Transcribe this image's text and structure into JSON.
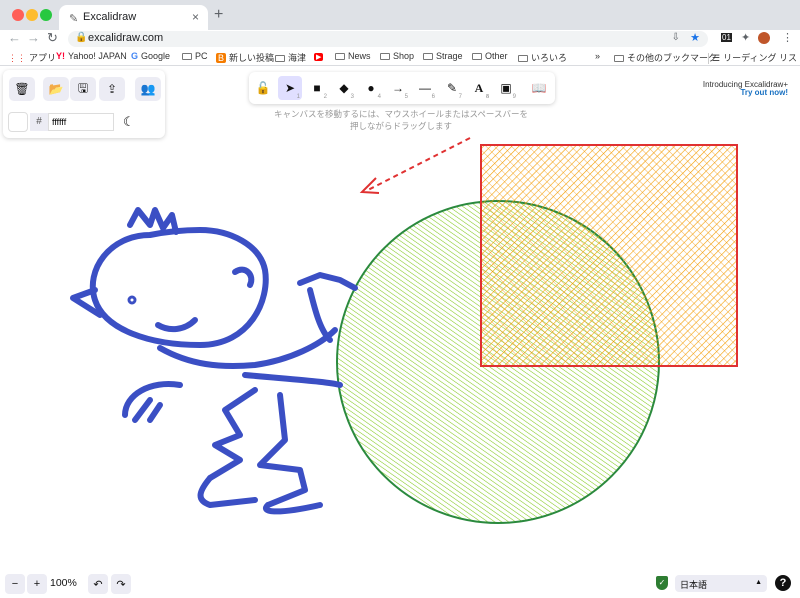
{
  "browser": {
    "tab_title": "Excalidraw",
    "url": "excalidraw.com",
    "new_tab": "+",
    "close_tab": "×",
    "ext_badge": "01"
  },
  "bookmarks": [
    {
      "label": "アプリ",
      "icon": "apps-grid-icon"
    },
    {
      "label": "Yahoo! JAPAN",
      "icon": "yahoo-icon"
    },
    {
      "label": "Google",
      "icon": "google-icon"
    },
    {
      "label": "PC",
      "icon": "folder-icon"
    },
    {
      "label": "新しい投稿",
      "icon": "blogger-icon"
    },
    {
      "label": "海津",
      "icon": "folder-icon"
    },
    {
      "label": "",
      "icon": "youtube-icon"
    },
    {
      "label": "News",
      "icon": "folder-icon"
    },
    {
      "label": "Shop",
      "icon": "folder-icon"
    },
    {
      "label": "Strage",
      "icon": "folder-icon"
    },
    {
      "label": "Other",
      "icon": "folder-icon"
    },
    {
      "label": "いろいろ",
      "icon": "folder-icon"
    }
  ],
  "bookmarks_right": {
    "more": "»",
    "other": "その他のブックマーク",
    "reading_list": "リーディング リスト"
  },
  "app": {
    "bg_hash": "#",
    "bg_color_value": "ffffff",
    "hint_line1": "キャンバスを移動するには、マウスホイールまたはスペースバーを",
    "hint_line2": "押しながらドラッグします",
    "promo_title": "Introducing Excalidraw+",
    "promo_link": "Try out now!",
    "zoom": "100%",
    "language": "日本語",
    "help": "?"
  },
  "tools": [
    {
      "name": "tool-lock",
      "glyph": "🔓",
      "num": ""
    },
    {
      "name": "tool-selection",
      "glyph": "➤",
      "num": "1"
    },
    {
      "name": "tool-rectangle",
      "glyph": "■",
      "num": "2"
    },
    {
      "name": "tool-diamond",
      "glyph": "◆",
      "num": "3"
    },
    {
      "name": "tool-ellipse",
      "glyph": "●",
      "num": "4"
    },
    {
      "name": "tool-arrow",
      "glyph": "→",
      "num": "5"
    },
    {
      "name": "tool-line",
      "glyph": "—",
      "num": "6"
    },
    {
      "name": "tool-draw",
      "glyph": "✎",
      "num": "7"
    },
    {
      "name": "tool-text",
      "glyph": "A",
      "num": "8"
    },
    {
      "name": "tool-image",
      "glyph": "▣",
      "num": "9"
    },
    {
      "name": "tool-library",
      "glyph": "📖",
      "num": ""
    }
  ],
  "colors": {
    "rect_stroke": "#e03131",
    "rect_fill": "#f59f00",
    "circle_stroke": "#2b8a3e",
    "circle_fill": "#82c91e",
    "figure": "#3b4fc4",
    "arrow": "#e03131",
    "selected_tool": "#e0dfff"
  }
}
